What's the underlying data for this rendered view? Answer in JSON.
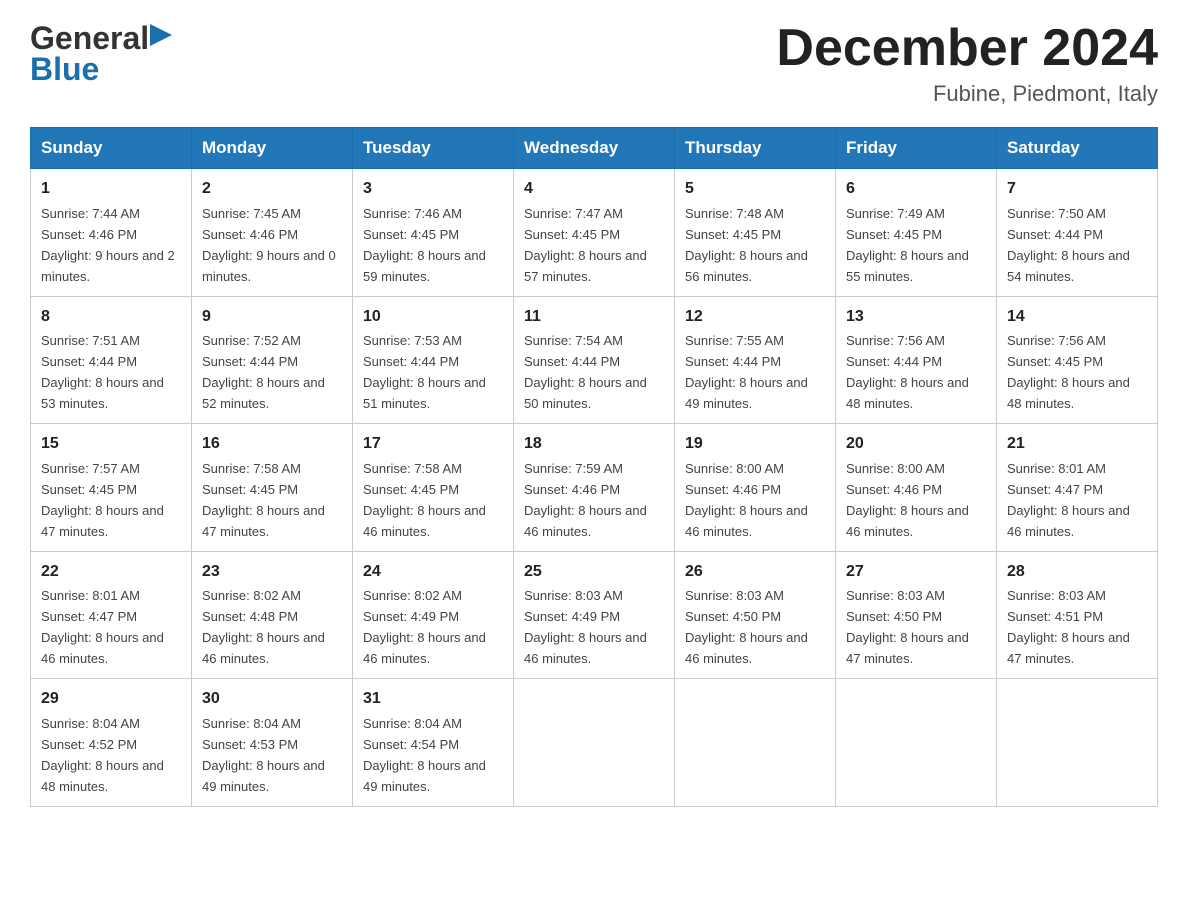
{
  "header": {
    "logo_general": "General",
    "logo_blue": "Blue",
    "month_title": "December 2024",
    "location": "Fubine, Piedmont, Italy"
  },
  "days_of_week": [
    "Sunday",
    "Monday",
    "Tuesday",
    "Wednesday",
    "Thursday",
    "Friday",
    "Saturday"
  ],
  "weeks": [
    [
      {
        "day": 1,
        "sunrise": "7:44 AM",
        "sunset": "4:46 PM",
        "daylight": "9 hours and 2 minutes."
      },
      {
        "day": 2,
        "sunrise": "7:45 AM",
        "sunset": "4:46 PM",
        "daylight": "9 hours and 0 minutes."
      },
      {
        "day": 3,
        "sunrise": "7:46 AM",
        "sunset": "4:45 PM",
        "daylight": "8 hours and 59 minutes."
      },
      {
        "day": 4,
        "sunrise": "7:47 AM",
        "sunset": "4:45 PM",
        "daylight": "8 hours and 57 minutes."
      },
      {
        "day": 5,
        "sunrise": "7:48 AM",
        "sunset": "4:45 PM",
        "daylight": "8 hours and 56 minutes."
      },
      {
        "day": 6,
        "sunrise": "7:49 AM",
        "sunset": "4:45 PM",
        "daylight": "8 hours and 55 minutes."
      },
      {
        "day": 7,
        "sunrise": "7:50 AM",
        "sunset": "4:44 PM",
        "daylight": "8 hours and 54 minutes."
      }
    ],
    [
      {
        "day": 8,
        "sunrise": "7:51 AM",
        "sunset": "4:44 PM",
        "daylight": "8 hours and 53 minutes."
      },
      {
        "day": 9,
        "sunrise": "7:52 AM",
        "sunset": "4:44 PM",
        "daylight": "8 hours and 52 minutes."
      },
      {
        "day": 10,
        "sunrise": "7:53 AM",
        "sunset": "4:44 PM",
        "daylight": "8 hours and 51 minutes."
      },
      {
        "day": 11,
        "sunrise": "7:54 AM",
        "sunset": "4:44 PM",
        "daylight": "8 hours and 50 minutes."
      },
      {
        "day": 12,
        "sunrise": "7:55 AM",
        "sunset": "4:44 PM",
        "daylight": "8 hours and 49 minutes."
      },
      {
        "day": 13,
        "sunrise": "7:56 AM",
        "sunset": "4:44 PM",
        "daylight": "8 hours and 48 minutes."
      },
      {
        "day": 14,
        "sunrise": "7:56 AM",
        "sunset": "4:45 PM",
        "daylight": "8 hours and 48 minutes."
      }
    ],
    [
      {
        "day": 15,
        "sunrise": "7:57 AM",
        "sunset": "4:45 PM",
        "daylight": "8 hours and 47 minutes."
      },
      {
        "day": 16,
        "sunrise": "7:58 AM",
        "sunset": "4:45 PM",
        "daylight": "8 hours and 47 minutes."
      },
      {
        "day": 17,
        "sunrise": "7:58 AM",
        "sunset": "4:45 PM",
        "daylight": "8 hours and 46 minutes."
      },
      {
        "day": 18,
        "sunrise": "7:59 AM",
        "sunset": "4:46 PM",
        "daylight": "8 hours and 46 minutes."
      },
      {
        "day": 19,
        "sunrise": "8:00 AM",
        "sunset": "4:46 PM",
        "daylight": "8 hours and 46 minutes."
      },
      {
        "day": 20,
        "sunrise": "8:00 AM",
        "sunset": "4:46 PM",
        "daylight": "8 hours and 46 minutes."
      },
      {
        "day": 21,
        "sunrise": "8:01 AM",
        "sunset": "4:47 PM",
        "daylight": "8 hours and 46 minutes."
      }
    ],
    [
      {
        "day": 22,
        "sunrise": "8:01 AM",
        "sunset": "4:47 PM",
        "daylight": "8 hours and 46 minutes."
      },
      {
        "day": 23,
        "sunrise": "8:02 AM",
        "sunset": "4:48 PM",
        "daylight": "8 hours and 46 minutes."
      },
      {
        "day": 24,
        "sunrise": "8:02 AM",
        "sunset": "4:49 PM",
        "daylight": "8 hours and 46 minutes."
      },
      {
        "day": 25,
        "sunrise": "8:03 AM",
        "sunset": "4:49 PM",
        "daylight": "8 hours and 46 minutes."
      },
      {
        "day": 26,
        "sunrise": "8:03 AM",
        "sunset": "4:50 PM",
        "daylight": "8 hours and 46 minutes."
      },
      {
        "day": 27,
        "sunrise": "8:03 AM",
        "sunset": "4:50 PM",
        "daylight": "8 hours and 47 minutes."
      },
      {
        "day": 28,
        "sunrise": "8:03 AM",
        "sunset": "4:51 PM",
        "daylight": "8 hours and 47 minutes."
      }
    ],
    [
      {
        "day": 29,
        "sunrise": "8:04 AM",
        "sunset": "4:52 PM",
        "daylight": "8 hours and 48 minutes."
      },
      {
        "day": 30,
        "sunrise": "8:04 AM",
        "sunset": "4:53 PM",
        "daylight": "8 hours and 49 minutes."
      },
      {
        "day": 31,
        "sunrise": "8:04 AM",
        "sunset": "4:54 PM",
        "daylight": "8 hours and 49 minutes."
      },
      null,
      null,
      null,
      null
    ]
  ],
  "labels": {
    "sunrise_prefix": "Sunrise: ",
    "sunset_prefix": "Sunset: ",
    "daylight_prefix": "Daylight: "
  }
}
